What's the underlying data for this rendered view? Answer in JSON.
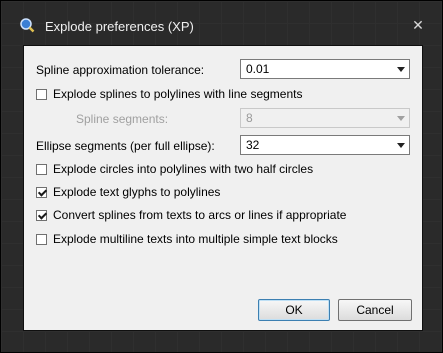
{
  "window": {
    "title": "Explode preferences (XP)",
    "close_glyph": "✕"
  },
  "fields": {
    "spline_tolerance": {
      "label": "Spline approximation tolerance:",
      "value": "0.01"
    },
    "explode_splines": {
      "label": "Explode splines to polylines with line segments",
      "checked": false
    },
    "spline_segments": {
      "label": "Spline segments:",
      "value": "8"
    },
    "ellipse_segments": {
      "label": "Ellipse segments (per full ellipse):",
      "value": "32"
    },
    "explode_circles": {
      "label": "Explode circles into polylines with two half circles",
      "checked": false
    },
    "explode_text_glyphs": {
      "label": "Explode text glyphs to polylines",
      "checked": true
    },
    "convert_splines": {
      "label": "Convert splines from texts to arcs or lines if appropriate",
      "checked": true
    },
    "explode_multiline": {
      "label": "Explode multiline texts into multiple simple text blocks",
      "checked": false
    }
  },
  "buttons": {
    "ok": "OK",
    "cancel": "Cancel"
  },
  "colors": {
    "dialog_bg": "#f0f0f0",
    "window_chrome": "#2a2a2a",
    "default_button_border": "#3c7fb1"
  },
  "icons": {
    "app": "app-icon",
    "close": "close-icon"
  }
}
